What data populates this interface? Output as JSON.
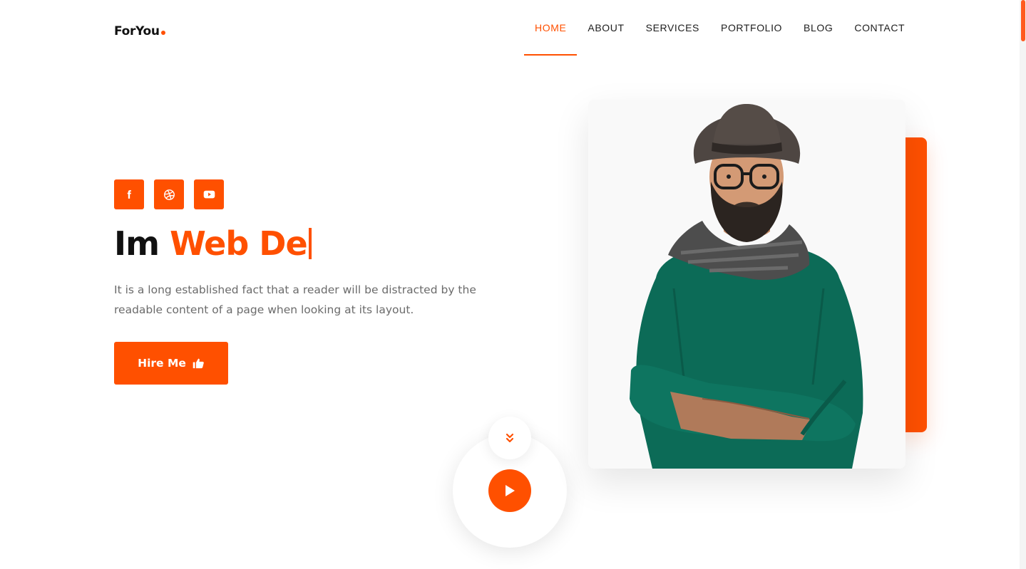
{
  "brand": {
    "name": "ForYou",
    "accent": "#ff5000"
  },
  "nav": {
    "items": [
      {
        "label": "HOME",
        "active": true
      },
      {
        "label": "ABOUT",
        "active": false
      },
      {
        "label": "SERVICES",
        "active": false
      },
      {
        "label": "PORTFOLIO",
        "active": false
      },
      {
        "label": "BLOG",
        "active": false
      },
      {
        "label": "CONTACT",
        "active": false
      }
    ]
  },
  "hero": {
    "socials": [
      "facebook-icon",
      "dribbble-icon",
      "youtube-icon"
    ],
    "headline_prefix": "Im",
    "headline_typed": "Web De",
    "description": "It is a long established fact that a reader will be distracted by the readable content of a page when looking at its layout.",
    "cta_label": "Hire Me",
    "cta_icon": "thumbs-up-icon"
  },
  "widgets": {
    "scroll_icon": "chevron-double-down-icon",
    "play_icon": "play-icon"
  },
  "portrait": {
    "subject": "person-photo"
  }
}
